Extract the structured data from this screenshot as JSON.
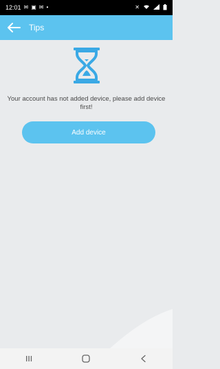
{
  "status_bar": {
    "time": "12:01",
    "left_icons": [
      "mail-icon",
      "image-icon",
      "mail-icon",
      "dot-icon"
    ],
    "right_icons": [
      "mute-icon",
      "wifi-icon",
      "signal-icon",
      "battery-icon"
    ]
  },
  "app_bar": {
    "title": "Tips",
    "back_icon": "back-arrow-icon"
  },
  "main": {
    "illustration": "hourglass-icon",
    "message": "Your account has not added device, please add device first!",
    "add_button_label": "Add device"
  },
  "nav_bar": {
    "items": [
      "recents-icon",
      "home-icon",
      "back-icon"
    ]
  },
  "colors": {
    "accent": "#5cc3ef",
    "background": "#e9ebed",
    "status_bar": "#000000",
    "text": "#4a4a4a"
  }
}
